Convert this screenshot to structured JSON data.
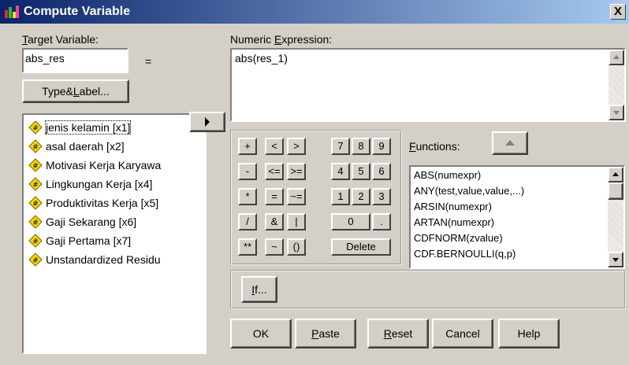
{
  "window": {
    "title": "Compute Variable",
    "close_glyph": "X"
  },
  "target": {
    "label_prefix": "",
    "label_u": "T",
    "label_rest": "arget Variable:",
    "value": "abs_res",
    "equals": "="
  },
  "type_label_button": {
    "pre": "Type&",
    "u": "L",
    "post": "abel..."
  },
  "variables": [
    "jenis kelamin [x1]",
    "asal daerah [x2]",
    "Motivasi Kerja Karyawa",
    "Lingkungan Kerja [x4]",
    "Produktivitas Kerja [x5]",
    "Gaji Sekarang [x6]",
    "Gaji Pertama [x7]",
    "Unstandardized Residu"
  ],
  "expression": {
    "label_pre": "Numeric ",
    "label_u": "E",
    "label_post": "xpression:",
    "value": "abs(res_1)"
  },
  "keypad": {
    "row1": [
      "+",
      "<",
      ">",
      "7",
      "8",
      "9"
    ],
    "row2": [
      "-",
      "<=",
      ">=",
      "4",
      "5",
      "6"
    ],
    "row3": [
      "*",
      "=",
      "~=",
      "1",
      "2",
      "3"
    ],
    "row4": [
      "/",
      "&",
      "|",
      "0",
      "."
    ],
    "row5": [
      "**",
      "~",
      "()",
      "Delete"
    ]
  },
  "functions": {
    "label_u": "F",
    "label_rest": "unctions:",
    "items": [
      "ABS(numexpr)",
      "ANY(test,value,value,...)",
      "ARSIN(numexpr)",
      "ARTAN(numexpr)",
      "CDFNORM(zvalue)",
      "CDF.BERNOULLI(q,p)"
    ]
  },
  "if_button": {
    "u": "I",
    "rest": "f..."
  },
  "buttons": {
    "ok": "OK",
    "paste_u": "P",
    "paste_rest": "aste",
    "reset_u": "R",
    "reset_rest": "eset",
    "cancel": "Cancel",
    "help": "Help"
  },
  "icons": {
    "variable": "numeric-variable-icon",
    "arrow": "right-arrow-icon"
  },
  "colors": {
    "title_start": "#0a246a",
    "title_end": "#a6caf0",
    "dialog_bg": "#d4d0c8",
    "variable_icon": "#f5d800"
  }
}
